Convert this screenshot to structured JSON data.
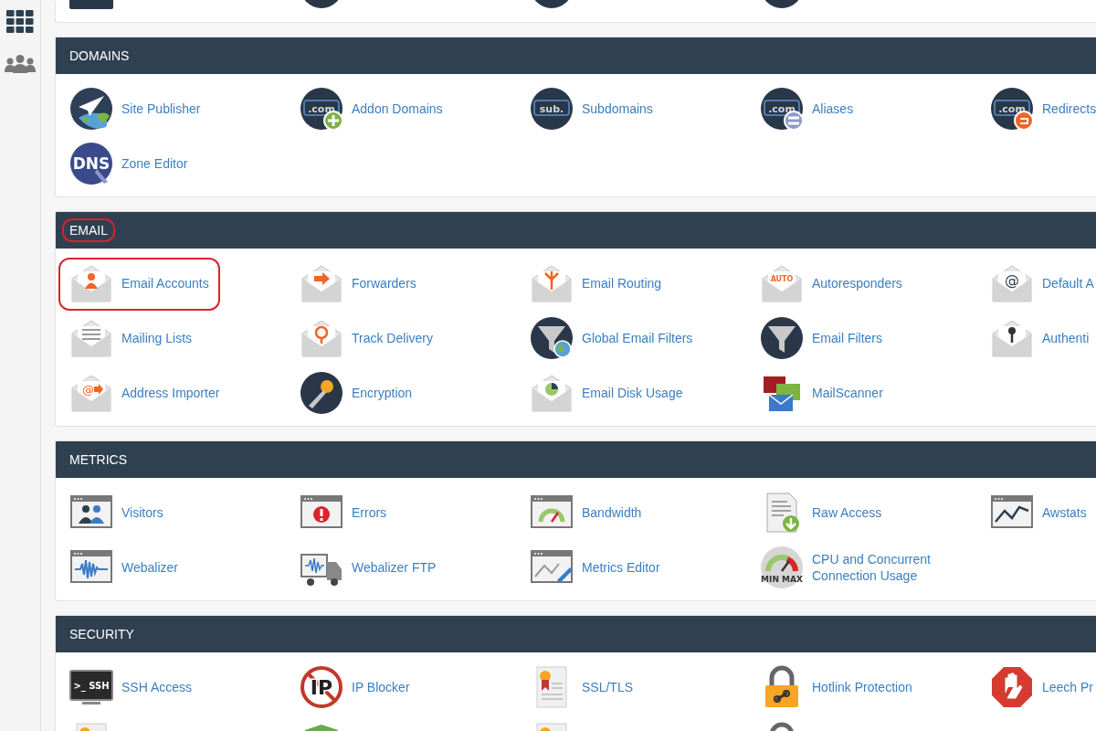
{
  "sections": [
    {
      "title": "DOMAINS",
      "title_highlighted": false,
      "items": [
        {
          "label": "Site Publisher",
          "highlighted": false
        },
        {
          "label": "Addon Domains",
          "icon_text": ".com",
          "highlighted": false
        },
        {
          "label": "Subdomains",
          "icon_text": "sub.",
          "highlighted": false
        },
        {
          "label": "Aliases",
          "icon_text": ".com",
          "highlighted": false
        },
        {
          "label": "Redirects",
          "icon_text": ".com",
          "highlighted": false
        },
        {
          "label": "Zone Editor",
          "icon_text": "DNS",
          "highlighted": false
        }
      ]
    },
    {
      "title": "EMAIL",
      "title_highlighted": true,
      "items": [
        {
          "label": "Email Accounts",
          "highlighted": true
        },
        {
          "label": "Forwarders",
          "highlighted": false
        },
        {
          "label": "Email Routing",
          "highlighted": false
        },
        {
          "label": "Autoresponders",
          "icon_text": "AUTO",
          "highlighted": false
        },
        {
          "label": "Default A",
          "icon_text": "@",
          "highlighted": false
        },
        {
          "label": "Mailing Lists",
          "highlighted": false
        },
        {
          "label": "Track Delivery",
          "highlighted": false
        },
        {
          "label": "Global Email Filters",
          "highlighted": false
        },
        {
          "label": "Email Filters",
          "highlighted": false
        },
        {
          "label": "Authenti",
          "highlighted": false
        },
        {
          "label": "Address Importer",
          "icon_text": "@",
          "highlighted": false
        },
        {
          "label": "Encryption",
          "highlighted": false
        },
        {
          "label": "Email Disk Usage",
          "highlighted": false
        },
        {
          "label": "MailScanner",
          "highlighted": false
        }
      ]
    },
    {
      "title": "METRICS",
      "title_highlighted": false,
      "items": [
        {
          "label": "Visitors",
          "highlighted": false
        },
        {
          "label": "Errors",
          "highlighted": false
        },
        {
          "label": "Bandwidth",
          "highlighted": false
        },
        {
          "label": "Raw Access",
          "highlighted": false
        },
        {
          "label": "Awstats",
          "highlighted": false
        },
        {
          "label": "Webalizer",
          "highlighted": false
        },
        {
          "label": "Webalizer FTP",
          "highlighted": false
        },
        {
          "label": "Metrics Editor",
          "highlighted": false
        },
        {
          "label": "CPU and Concurrent Connection Usage",
          "icon_text": "MIN MAX",
          "highlighted": false
        }
      ]
    },
    {
      "title": "SECURITY",
      "title_highlighted": false,
      "items": [
        {
          "label": "SSH Access",
          "icon_text": ">_ SSH",
          "highlighted": false
        },
        {
          "label": "IP Blocker",
          "icon_text": "IP",
          "highlighted": false
        },
        {
          "label": "SSL/TLS",
          "highlighted": false
        },
        {
          "label": "Hotlink Protection",
          "highlighted": false
        },
        {
          "label": "Leech Pr",
          "highlighted": false
        }
      ]
    }
  ]
}
